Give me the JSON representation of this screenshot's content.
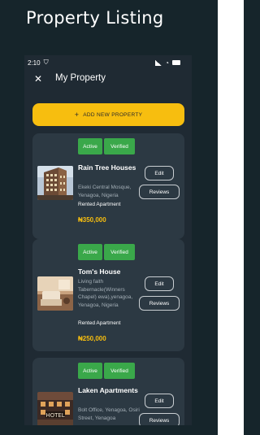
{
  "page_heading": "Property Listing",
  "status_bar": {
    "time": "2:10"
  },
  "app_bar": {
    "title": "My Property"
  },
  "add_button": {
    "icon": "+",
    "label": "ADD NEW PROPERTY"
  },
  "properties": [
    {
      "badge_active": "Active",
      "badge_verified": "Verified",
      "name": "Rain Tree Houses",
      "address": "Ekeki Central Mosque, Yenagoa, Nigeria",
      "type": "Rented Apartment",
      "price": "₦350,000",
      "edit_label": "Edit",
      "reviews_label": "Reviews"
    },
    {
      "badge_active": "Active",
      "badge_verified": "Verified",
      "name": "Tom's House",
      "address": "Living faith Tabernacle(Winners Chapel) ewa),yenagoa, Yenagoa, Nigeria",
      "type": "Rented Apartment",
      "price": "₦250,000",
      "edit_label": "Edit",
      "reviews_label": "Reviews"
    },
    {
      "badge_active": "Active",
      "badge_verified": "Verified",
      "name": "Laken Apartments",
      "address": "Bolt Office, Yenagoa, Osiri Street, Yenagoa",
      "type": "",
      "price": "",
      "edit_label": "Edit",
      "reviews_label": "Reviews"
    }
  ],
  "colors": {
    "background": "#16252b",
    "card": "#2c3943",
    "accent": "#f7be0f",
    "badge": "#3aa84a"
  }
}
